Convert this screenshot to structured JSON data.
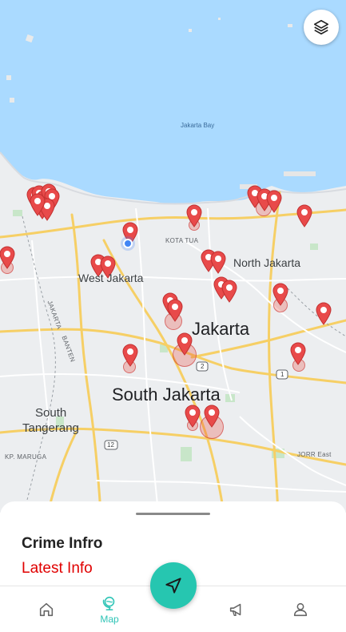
{
  "map": {
    "labels": {
      "jakarta_bay": "Jakarta Bay",
      "kota_tua": "KOTA TUA",
      "north_jakarta": "North Jakarta",
      "west_jakarta": "West Jakarta",
      "jakarta": "Jakarta",
      "south_jakarta": "South Jakarta",
      "south_tangerang_1": "South",
      "south_tangerang_2": "Tangerang",
      "kp_maruga": "KP. MARUGA",
      "jorr_east": "JORR East",
      "banten": "BANTEN",
      "jakarta_road": "JAKARTA",
      "route_2": "2",
      "route_1": "1",
      "route_12": "12"
    },
    "marker_color": "#e84a4a",
    "water_color": "#aadaff",
    "land_color": "#f1f3f4",
    "layers_icon": "layers-icon"
  },
  "sheet": {
    "title": "Crime Infro",
    "subtitle": "Latest Info",
    "subtitle_color": "#e00000"
  },
  "nav": {
    "items": [
      {
        "id": "home",
        "icon": "home-icon",
        "label": ""
      },
      {
        "id": "map",
        "icon": "globe-icon",
        "label": "Map",
        "active": true
      },
      {
        "id": "report",
        "icon": "megaphone-icon",
        "label": ""
      },
      {
        "id": "profile",
        "icon": "user-icon",
        "label": ""
      }
    ],
    "fab_icon": "navigation-arrow-icon",
    "accent": "#26c6b0"
  }
}
